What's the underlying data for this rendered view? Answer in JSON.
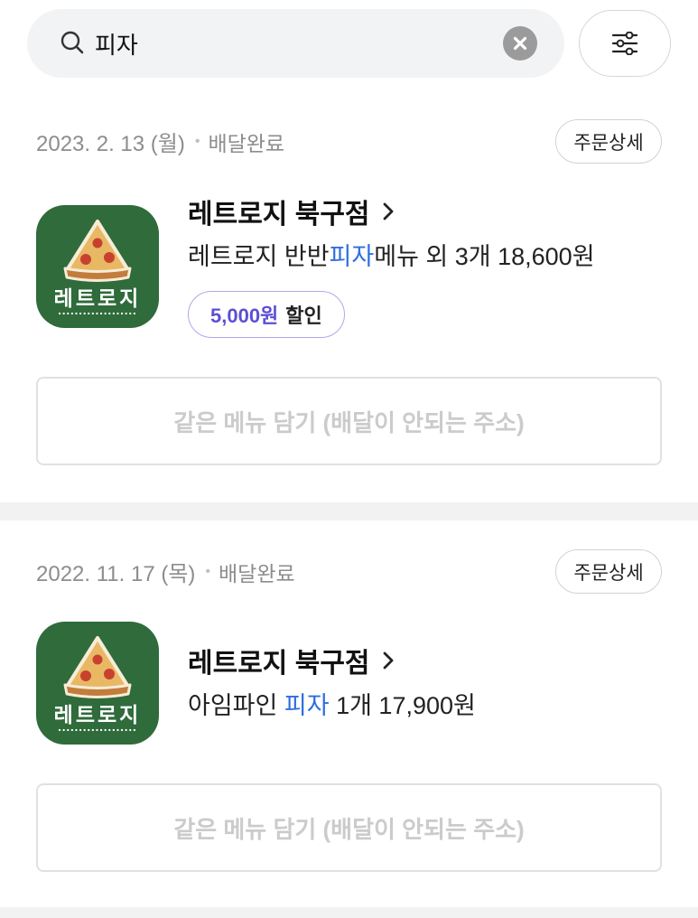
{
  "search": {
    "query": "피자"
  },
  "icons": {
    "search": "search-icon",
    "clear": "clear-icon",
    "filter": "filter-icon",
    "chevron": "chevron-right-icon",
    "logo": "pizza-slice-icon"
  },
  "orders": [
    {
      "date": "2023. 2. 13 (월)",
      "separator": "•",
      "status": "배달완료",
      "detail_button": "주문상세",
      "store_logo_text": "레트로지",
      "store_name": "레트로지 북구점",
      "summary_prefix": "레트로지 반반",
      "summary_highlight": "피자",
      "summary_suffix": "메뉴 외 3개 18,600원",
      "discount_amount": "5,000원",
      "discount_label": "할인",
      "reorder_button": "같은 메뉴 담기 (배달이 안되는 주소)"
    },
    {
      "date": "2022. 11. 17 (목)",
      "separator": "•",
      "status": "배달완료",
      "detail_button": "주문상세",
      "store_logo_text": "레트로지",
      "store_name": "레트로지 북구점",
      "summary_prefix": "아임파인 ",
      "summary_highlight": "피자",
      "summary_suffix": " 1개 17,900원",
      "reorder_button": "같은 메뉴 담기 (배달이 안되는 주소)"
    }
  ],
  "colors": {
    "highlight": "#2f6ee0",
    "discount": "#5b4fd4",
    "discount_border": "#b1a6ec",
    "logo_bg": "#2f6b3b",
    "muted_text": "#8d8d8d",
    "disabled_text": "#cbcbcb"
  }
}
